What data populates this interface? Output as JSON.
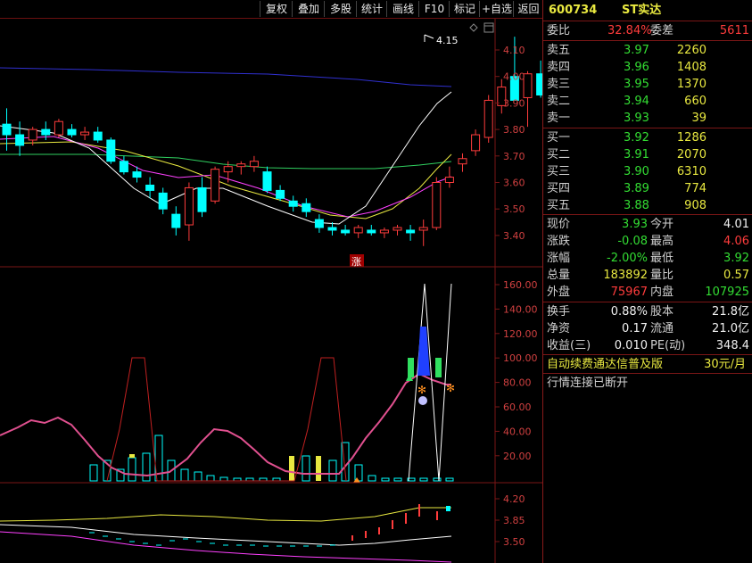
{
  "toolbar": {
    "buttons": [
      "复权",
      "叠加",
      "多股",
      "统计",
      "画线",
      "F10",
      "标记",
      "+自选",
      "返回"
    ]
  },
  "colors": {
    "up": "#ff3c3c",
    "down": "#00ffff",
    "ma_white": "#ffffff",
    "ma_yellow": "#e8e840",
    "ma_magenta": "#ff40ff",
    "ma_green": "#30d060",
    "ma_blue": "#3030d0",
    "separator": "#7a1616"
  },
  "main_chart": {
    "y_ticks": [
      "4.10",
      "4.00",
      "3.90",
      "3.80",
      "3.70",
      "3.60",
      "3.50",
      "3.40"
    ],
    "high_annotation": "4.15",
    "limit_up_marker": "涨",
    "candles": [
      {
        "o": 3.82,
        "h": 3.88,
        "l": 3.72,
        "c": 3.78
      },
      {
        "o": 3.78,
        "h": 3.83,
        "l": 3.7,
        "c": 3.74
      },
      {
        "o": 3.76,
        "h": 3.81,
        "l": 3.74,
        "c": 3.8
      },
      {
        "o": 3.8,
        "h": 3.83,
        "l": 3.76,
        "c": 3.78
      },
      {
        "o": 3.78,
        "h": 3.84,
        "l": 3.77,
        "c": 3.83
      },
      {
        "o": 3.8,
        "h": 3.82,
        "l": 3.77,
        "c": 3.78
      },
      {
        "o": 3.78,
        "h": 3.81,
        "l": 3.76,
        "c": 3.79
      },
      {
        "o": 3.79,
        "h": 3.81,
        "l": 3.75,
        "c": 3.76
      },
      {
        "o": 3.76,
        "h": 3.77,
        "l": 3.67,
        "c": 3.68
      },
      {
        "o": 3.68,
        "h": 3.7,
        "l": 3.63,
        "c": 3.64
      },
      {
        "o": 3.64,
        "h": 3.66,
        "l": 3.6,
        "c": 3.62
      },
      {
        "o": 3.59,
        "h": 3.62,
        "l": 3.54,
        "c": 3.57
      },
      {
        "o": 3.56,
        "h": 3.58,
        "l": 3.48,
        "c": 3.5
      },
      {
        "o": 3.48,
        "h": 3.51,
        "l": 3.4,
        "c": 3.43
      },
      {
        "o": 3.44,
        "h": 3.6,
        "l": 3.38,
        "c": 3.58
      },
      {
        "o": 3.58,
        "h": 3.62,
        "l": 3.47,
        "c": 3.49
      },
      {
        "o": 3.53,
        "h": 3.66,
        "l": 3.52,
        "c": 3.65
      },
      {
        "o": 3.64,
        "h": 3.68,
        "l": 3.6,
        "c": 3.66
      },
      {
        "o": 3.66,
        "h": 3.68,
        "l": 3.63,
        "c": 3.67
      },
      {
        "o": 3.66,
        "h": 3.7,
        "l": 3.64,
        "c": 3.68
      },
      {
        "o": 3.64,
        "h": 3.66,
        "l": 3.56,
        "c": 3.57
      },
      {
        "o": 3.57,
        "h": 3.59,
        "l": 3.53,
        "c": 3.54
      },
      {
        "o": 3.53,
        "h": 3.55,
        "l": 3.49,
        "c": 3.51
      },
      {
        "o": 3.52,
        "h": 3.54,
        "l": 3.47,
        "c": 3.49
      },
      {
        "o": 3.46,
        "h": 3.48,
        "l": 3.41,
        "c": 3.43
      },
      {
        "o": 3.43,
        "h": 3.45,
        "l": 3.4,
        "c": 3.42
      },
      {
        "o": 3.42,
        "h": 3.44,
        "l": 3.4,
        "c": 3.41
      },
      {
        "o": 3.41,
        "h": 3.44,
        "l": 3.39,
        "c": 3.43
      },
      {
        "o": 3.42,
        "h": 3.44,
        "l": 3.4,
        "c": 3.41
      },
      {
        "o": 3.41,
        "h": 3.43,
        "l": 3.39,
        "c": 3.42
      },
      {
        "o": 3.42,
        "h": 3.44,
        "l": 3.4,
        "c": 3.43
      },
      {
        "o": 3.42,
        "h": 3.44,
        "l": 3.38,
        "c": 3.41
      },
      {
        "o": 3.42,
        "h": 3.46,
        "l": 3.36,
        "c": 3.43
      },
      {
        "o": 3.43,
        "h": 3.62,
        "l": 3.42,
        "c": 3.6
      },
      {
        "o": 3.6,
        "h": 3.66,
        "l": 3.58,
        "c": 3.62
      },
      {
        "o": 3.67,
        "h": 3.71,
        "l": 3.64,
        "c": 3.69
      },
      {
        "o": 3.72,
        "h": 3.8,
        "l": 3.7,
        "c": 3.78
      },
      {
        "o": 3.77,
        "h": 3.93,
        "l": 3.75,
        "c": 3.91
      },
      {
        "o": 3.89,
        "h": 3.99,
        "l": 3.86,
        "c": 3.96
      },
      {
        "o": 4.0,
        "h": 4.15,
        "l": 3.91,
        "c": 3.91
      },
      {
        "o": 3.92,
        "h": 4.02,
        "l": 3.81,
        "c": 4.01
      },
      {
        "o": 4.01,
        "h": 4.06,
        "l": 3.92,
        "c": 3.93
      }
    ]
  },
  "indicator_chart": {
    "y_ticks": [
      "160.00",
      "140.00",
      "120.00",
      "100.00",
      "80.00",
      "60.00",
      "40.00",
      "20.00"
    ]
  },
  "bottom_chart": {
    "y_ticks": [
      "4.20",
      "3.85",
      "3.50"
    ]
  },
  "quote": {
    "header": {
      "code": "600734",
      "name": "ST实达"
    },
    "weibi": {
      "label": "委比",
      "value": "32.84%",
      "diff_label": "委差",
      "diff_value": "5611"
    },
    "asks": [
      {
        "label": "卖五",
        "price": "3.97",
        "vol": "2260"
      },
      {
        "label": "卖四",
        "price": "3.96",
        "vol": "1408"
      },
      {
        "label": "卖三",
        "price": "3.95",
        "vol": "1370"
      },
      {
        "label": "卖二",
        "price": "3.94",
        "vol": "660"
      },
      {
        "label": "卖一",
        "price": "3.93",
        "vol": "39"
      }
    ],
    "bids": [
      {
        "label": "买一",
        "price": "3.92",
        "vol": "1286"
      },
      {
        "label": "买二",
        "price": "3.91",
        "vol": "2070"
      },
      {
        "label": "买三",
        "price": "3.90",
        "vol": "6310"
      },
      {
        "label": "买四",
        "price": "3.89",
        "vol": "774"
      },
      {
        "label": "买五",
        "price": "3.88",
        "vol": "908"
      }
    ],
    "stats": [
      {
        "l1": "现价",
        "v1": "3.93",
        "c1": "green",
        "l2": "今开",
        "v2": "4.01",
        "c2": "white"
      },
      {
        "l1": "涨跌",
        "v1": "-0.08",
        "c1": "green",
        "l2": "最高",
        "v2": "4.06",
        "c2": "red"
      },
      {
        "l1": "涨幅",
        "v1": "-2.00%",
        "c1": "green",
        "l2": "最低",
        "v2": "3.92",
        "c2": "green"
      },
      {
        "l1": "总量",
        "v1": "183892",
        "c1": "yellow",
        "l2": "量比",
        "v2": "0.57",
        "c2": "yellow"
      },
      {
        "l1": "外盘",
        "v1": "75967",
        "c1": "red",
        "l2": "内盘",
        "v2": "107925",
        "c2": "green"
      }
    ],
    "fin": [
      {
        "l1": "换手",
        "v1": "0.88%",
        "l2": "股本",
        "v2": "21.8亿"
      },
      {
        "l1": "净资",
        "v1": "0.17",
        "l2": "流通",
        "v2": "21.0亿"
      },
      {
        "l1": "收益(三)",
        "v1": "0.010",
        "l2": "PE(动)",
        "v2": "348.4"
      }
    ],
    "promo": {
      "text": "自动续费通达信普及版",
      "price": "30元/月"
    },
    "status": "行情连接已断开"
  }
}
